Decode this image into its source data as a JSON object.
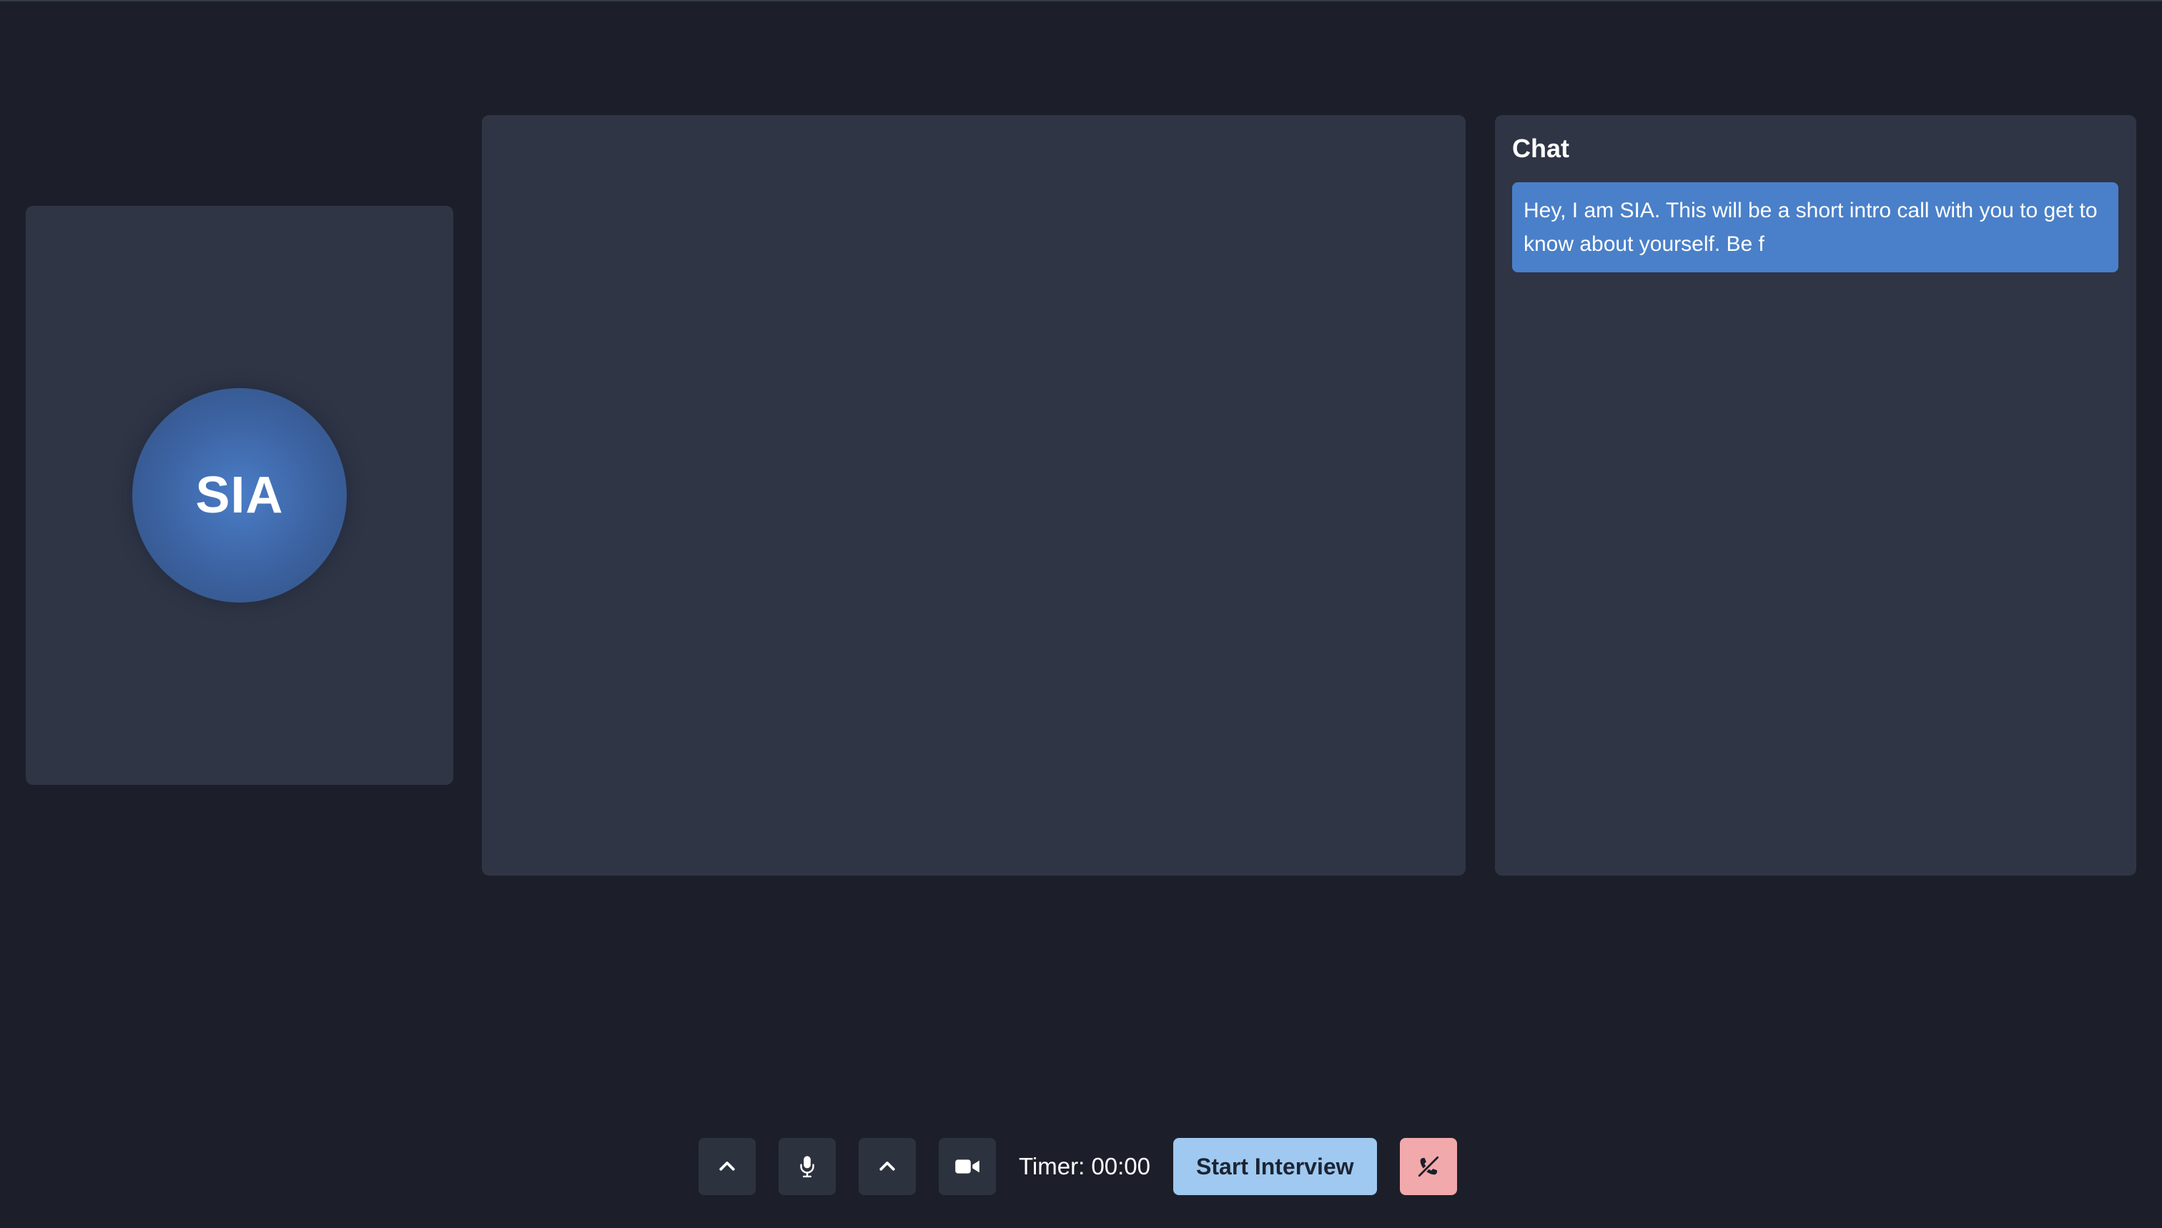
{
  "agent": {
    "avatar_label": "SIA"
  },
  "chat": {
    "title": "Chat",
    "messages": [
      {
        "text": "Hey, I am SIA. This will be a short intro call with you to get to know about yourself. Be f"
      }
    ]
  },
  "controls": {
    "mic_options_icon": "chevron-up-icon",
    "mic_icon": "microphone-icon",
    "camera_options_icon": "chevron-up-icon",
    "camera_icon": "video-camera-icon",
    "timer_text": "Timer: 00:00",
    "start_label": "Start Interview",
    "end_icon": "phone-hangup-icon"
  },
  "colors": {
    "background": "#1c1f2a",
    "panel": "#2f3545",
    "chat_bubble": "#4a80c9",
    "start_button": "#9fc9f0",
    "end_button": "#f2a9ab"
  }
}
